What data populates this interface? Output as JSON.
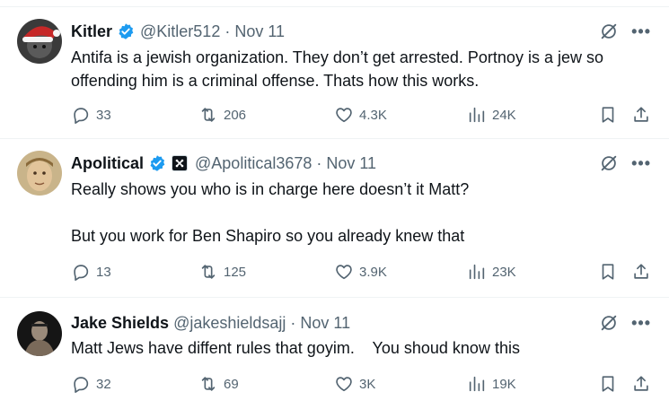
{
  "colors": {
    "text": "#0f1419",
    "secondary": "#536471",
    "verified": "#1d9bf0",
    "divider": "#eff3f4"
  },
  "icons": [
    "reply-icon",
    "retweet-icon",
    "like-icon",
    "views-icon",
    "bookmark-icon",
    "share-icon",
    "grok-icon",
    "more-icon",
    "verified-badge-icon"
  ],
  "tweets": [
    {
      "name": "Kitler",
      "handle": "@Kitler512",
      "dot": "·",
      "date": "Nov 11",
      "text": "Antifa is a jewish organization. They don’t get arrested. Portnoy is a jew so offending him is a criminal offense. Thats how this works.",
      "replies": "33",
      "retweets": "206",
      "likes": "4.3K",
      "views": "24K"
    },
    {
      "name": "Apolitical",
      "handle": "@Apolitical3678",
      "dot": "·",
      "date": "Nov 11",
      "text": "Really shows you who is in charge here doesn’t it Matt?\n\nBut you work for Ben Shapiro so you already knew that",
      "replies": "13",
      "retweets": "125",
      "likes": "3.9K",
      "views": "23K"
    },
    {
      "name": "Jake Shields",
      "handle": "@jakeshieldsajj",
      "dot": "·",
      "date": "Nov 11",
      "text": "Matt Jews have diffent rules that goyim.    You shoud know this",
      "replies": "32",
      "retweets": "69",
      "likes": "3K",
      "views": "19K"
    }
  ],
  "more_label": "•••"
}
